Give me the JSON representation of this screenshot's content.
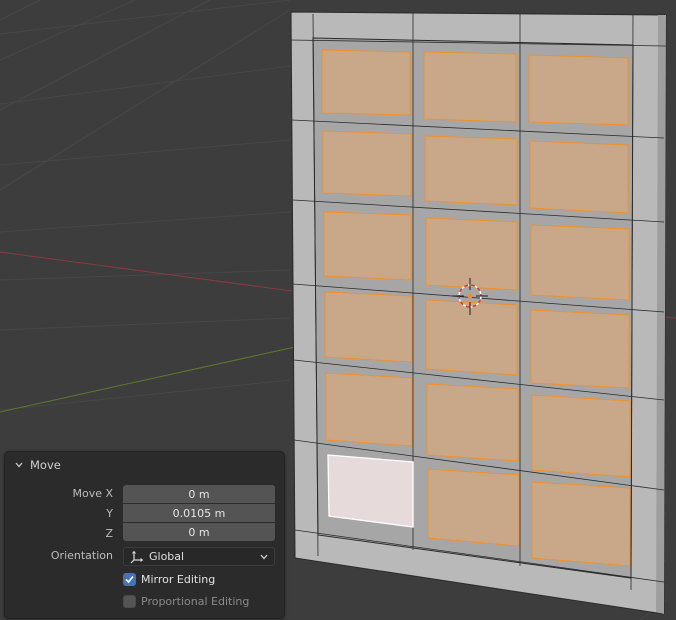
{
  "operator_panel": {
    "title": "Move",
    "move_x": {
      "label": "Move X",
      "value": "0 m"
    },
    "move_y": {
      "label": "Y",
      "value": "0.0105 m"
    },
    "move_z": {
      "label": "Z",
      "value": "0 m"
    },
    "orientation": {
      "label": "Orientation",
      "value": "Global",
      "icon": "orientation-axes-icon"
    },
    "mirror_editing": {
      "label": "Mirror Editing",
      "checked": true
    },
    "proportional_editing": {
      "label": "Proportional Editing",
      "checked": false,
      "enabled": false
    }
  },
  "viewport": {
    "background_color": "#3d3d3d",
    "grid_line_color": "#474747",
    "x_axis_color": "#8a3a3e",
    "y_axis_color": "#5d7a2a",
    "mesh_face_color": "#b4b4b4",
    "selected_face_color": "#c9a88a",
    "selected_edge_color": "#f0902a",
    "active_face_color": "#e6dada",
    "pane_grid": {
      "rows": 6,
      "cols": 3
    },
    "active_pane": {
      "row": 6,
      "col": 1
    },
    "selected_panes": 17
  }
}
